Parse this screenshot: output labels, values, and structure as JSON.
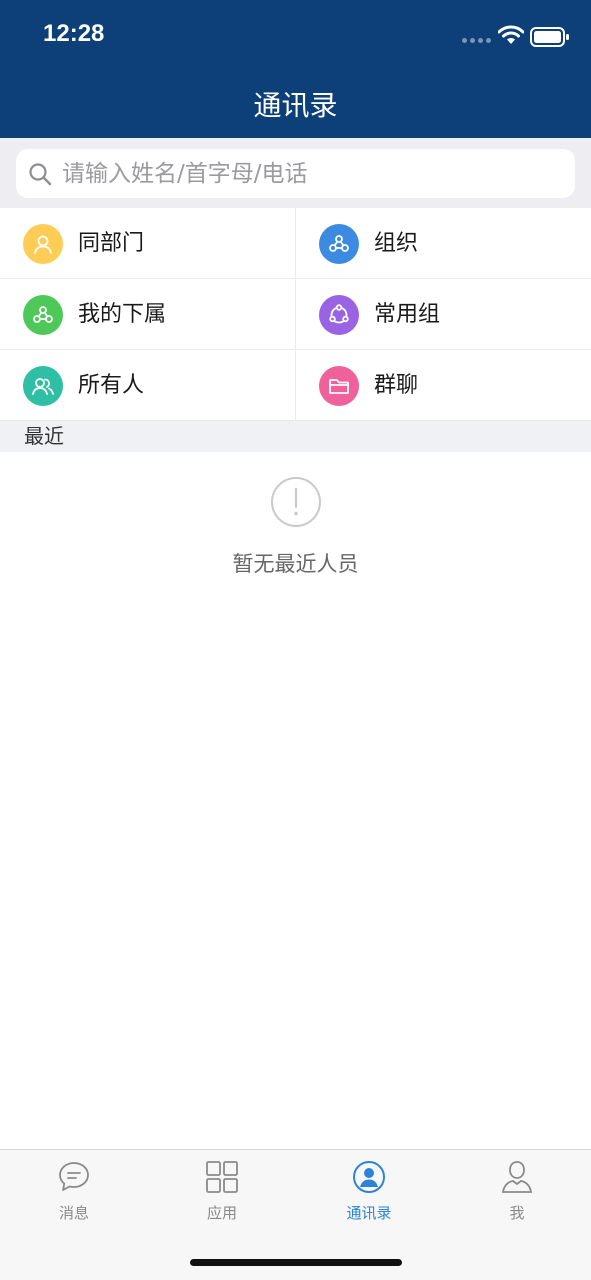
{
  "status_bar": {
    "time": "12:28"
  },
  "header": {
    "title": "通讯录"
  },
  "search": {
    "placeholder": "请输入姓名/首字母/电话"
  },
  "grid_items": [
    {
      "label": "同部门",
      "icon": "person-icon",
      "color": "#ffcc55"
    },
    {
      "label": "组织",
      "icon": "organization-icon",
      "color": "#3d8be0"
    },
    {
      "label": "我的下属",
      "icon": "subordinates-icon",
      "color": "#4fc85a"
    },
    {
      "label": "常用组",
      "icon": "group-icon",
      "color": "#9a63e3"
    },
    {
      "label": "所有人",
      "icon": "people-icon",
      "color": "#2fbfa4"
    },
    {
      "label": "群聊",
      "icon": "folder-icon",
      "color": "#f0609a"
    }
  ],
  "recent": {
    "section_label": "最近",
    "empty_text": "暂无最近人员"
  },
  "tabbar": {
    "items": [
      {
        "label": "消息",
        "icon": "chat-icon",
        "active": false
      },
      {
        "label": "应用",
        "icon": "apps-icon",
        "active": false
      },
      {
        "label": "通讯录",
        "icon": "contacts-icon",
        "active": true
      },
      {
        "label": "我",
        "icon": "profile-icon",
        "active": false
      }
    ],
    "active_color": "#2f83d6",
    "inactive_color": "#8a8a8a"
  },
  "colors": {
    "header_bg": "#0d3f78",
    "page_bg": "#eeeef2"
  }
}
